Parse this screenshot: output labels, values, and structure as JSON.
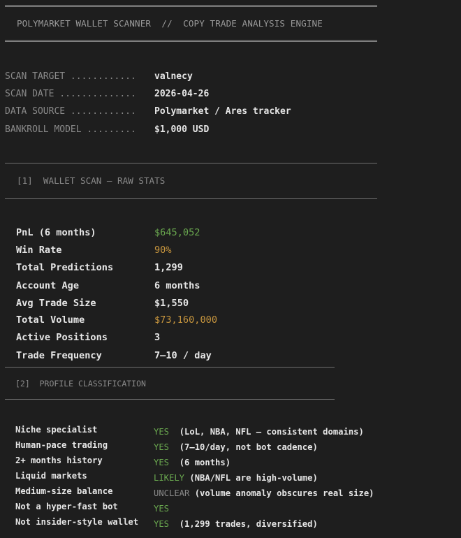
{
  "banner": {
    "title": "POLYMARKET WALLET SCANNER  //  COPY TRADE ANALYSIS ENGINE"
  },
  "meta": [
    {
      "key": "SCAN TARGET ............",
      "value": "valnecy"
    },
    {
      "key": "SCAN DATE ..............",
      "value": "2026-04-26"
    },
    {
      "key": "DATA SOURCE ............",
      "value": "Polymarket / Ares tracker"
    },
    {
      "key": "BANKROLL MODEL .........",
      "value": "$1,000 USD"
    }
  ],
  "section1": {
    "title": "[1]  WALLET SCAN — RAW STATS",
    "stats": [
      {
        "key": "PnL (6 months)",
        "value": "$645,052",
        "color": "#6aa84f"
      },
      {
        "key": "Win Rate",
        "value": "90%",
        "color": "#c8963e"
      },
      {
        "key": "Total Predictions",
        "value": "1,299",
        "color": "#e6e6e6"
      },
      {
        "key": "Account Age",
        "value": "6 months",
        "color": "#e6e6e6"
      },
      {
        "key": "Avg Trade Size",
        "value": "$1,550",
        "color": "#e6e6e6"
      },
      {
        "key": "Total Volume",
        "value": "$73,160,000",
        "color": "#c8963e"
      },
      {
        "key": "Active Positions",
        "value": "3",
        "color": "#e6e6e6"
      },
      {
        "key": "Trade Frequency",
        "value": "7–10 / day",
        "color": "#e6e6e6"
      }
    ]
  },
  "section2": {
    "title": "[2]  PROFILE CLASSIFICATION",
    "rows": [
      {
        "key": "Niche specialist",
        "verdict": "YES",
        "verdict_color": "#6aa84f",
        "note": "  (LoL, NBA, NFL — consistent domains)"
      },
      {
        "key": "Human-pace trading",
        "verdict": "YES",
        "verdict_color": "#6aa84f",
        "note": "  (7–10/day, not bot cadence)"
      },
      {
        "key": "2+ months history",
        "verdict": "YES",
        "verdict_color": "#6aa84f",
        "note": "  (6 months)"
      },
      {
        "key": "Liquid markets",
        "verdict": "LIKELY",
        "verdict_color": "#6aa84f",
        "note": " (NBA/NFL are high-volume)"
      },
      {
        "key": "Medium-size balance",
        "verdict": "UNCLEAR",
        "verdict_color": "#8a8a8a",
        "note": " (volume anomaly obscures real size)"
      },
      {
        "key": "Not a hyper-fast bot",
        "verdict": "YES",
        "verdict_color": "#6aa84f",
        "note": ""
      },
      {
        "key": "Not insider-style wallet",
        "verdict": "YES",
        "verdict_color": "#6aa84f",
        "note": "  (1,299 trades, diversified)"
      }
    ]
  }
}
